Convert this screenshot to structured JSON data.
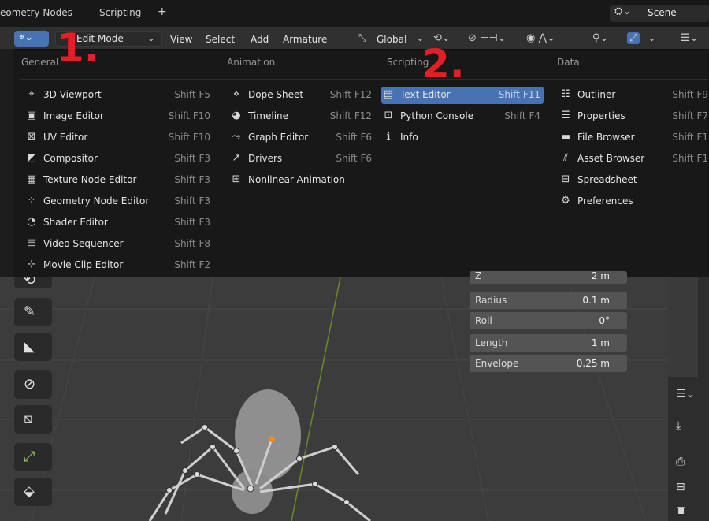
{
  "topbar": {
    "tabs": [
      "eometry Nodes",
      "Scripting",
      "+"
    ],
    "scene_icon": "scene-icon",
    "scene_label": "Scene"
  },
  "header": {
    "editor_type_icon": "3d-viewport-icon",
    "mode": "Edit Mode",
    "menus": [
      "View",
      "Select",
      "Add",
      "Armature"
    ],
    "transform_orientation": "Global"
  },
  "menu": {
    "columns": [
      {
        "heading": "General",
        "items": [
          {
            "icon": "3d-viewport-icon",
            "label": "3D Viewport",
            "shortcut": "Shift F5"
          },
          {
            "icon": "image-editor-icon",
            "label": "Image Editor",
            "shortcut": "Shift F10"
          },
          {
            "icon": "uv-editor-icon",
            "label": "UV Editor",
            "shortcut": "Shift F10"
          },
          {
            "icon": "compositor-icon",
            "label": "Compositor",
            "shortcut": "Shift F3"
          },
          {
            "icon": "texture-node-icon",
            "label": "Texture Node Editor",
            "shortcut": "Shift F3"
          },
          {
            "icon": "geometry-node-icon",
            "label": "Geometry Node Editor",
            "shortcut": "Shift F3"
          },
          {
            "icon": "shader-editor-icon",
            "label": "Shader Editor",
            "shortcut": "Shift F3"
          },
          {
            "icon": "video-sequencer-icon",
            "label": "Video Sequencer",
            "shortcut": "Shift F8"
          },
          {
            "icon": "movie-clip-icon",
            "label": "Movie Clip Editor",
            "shortcut": "Shift F2"
          }
        ]
      },
      {
        "heading": "Animation",
        "items": [
          {
            "icon": "dope-sheet-icon",
            "label": "Dope Sheet",
            "shortcut": "Shift F12"
          },
          {
            "icon": "timeline-icon",
            "label": "Timeline",
            "shortcut": "Shift F12"
          },
          {
            "icon": "graph-editor-icon",
            "label": "Graph Editor",
            "shortcut": "Shift F6"
          },
          {
            "icon": "drivers-icon",
            "label": "Drivers",
            "shortcut": "Shift F6"
          },
          {
            "icon": "nla-icon",
            "label": "Nonlinear Animation",
            "shortcut": ""
          }
        ]
      },
      {
        "heading": "Scripting",
        "items": [
          {
            "icon": "text-editor-icon",
            "label": "Text Editor",
            "shortcut": "Shift F11"
          },
          {
            "icon": "python-console-icon",
            "label": "Python Console",
            "shortcut": "Shift F4"
          },
          {
            "icon": "info-icon",
            "label": "Info",
            "shortcut": ""
          }
        ]
      },
      {
        "heading": "Data",
        "items": [
          {
            "icon": "outliner-icon",
            "label": "Outliner",
            "shortcut": "Shift F9"
          },
          {
            "icon": "properties-icon",
            "label": "Properties",
            "shortcut": "Shift F7"
          },
          {
            "icon": "file-browser-icon",
            "label": "File Browser",
            "shortcut": "Shift F1"
          },
          {
            "icon": "asset-browser-icon",
            "label": "Asset Browser",
            "shortcut": "Shift F1"
          },
          {
            "icon": "spreadsheet-icon",
            "label": "Spreadsheet",
            "shortcut": ""
          },
          {
            "icon": "preferences-icon",
            "label": "Preferences",
            "shortcut": ""
          }
        ]
      }
    ],
    "active_item": "Text Editor"
  },
  "annotations": [
    "1.",
    "2."
  ],
  "npanel": {
    "rows": [
      {
        "label": "Z",
        "value": "2 m"
      },
      {
        "label": "Radius",
        "value": "0.1 m"
      },
      {
        "label": "Roll",
        "value": "0°"
      },
      {
        "label": "Length",
        "value": "1 m"
      },
      {
        "label": "Envelope",
        "value": "0.25 m"
      }
    ]
  },
  "colors": {
    "accent": "#4772b3",
    "annotation": "#e31e24",
    "menu_bg": "#181818",
    "viewport_bg": "#3c3c3c"
  }
}
